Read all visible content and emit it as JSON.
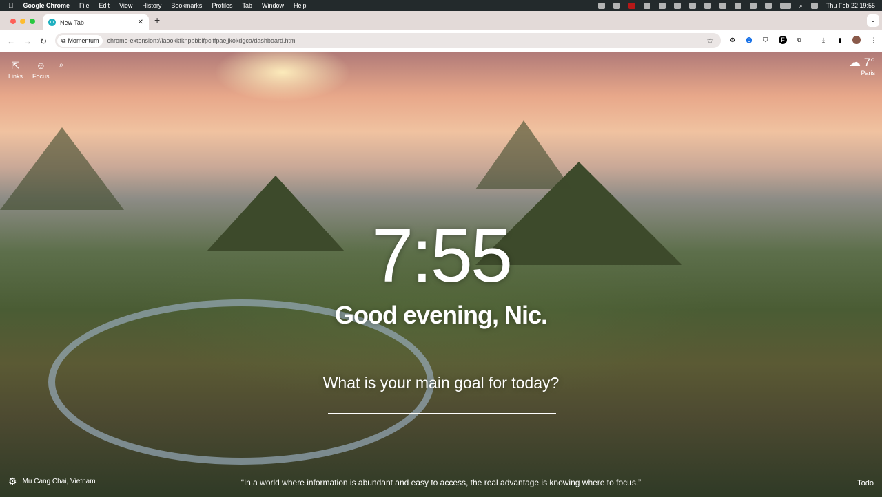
{
  "menubar": {
    "app": "Google Chrome",
    "items": [
      "File",
      "Edit",
      "View",
      "History",
      "Bookmarks",
      "Profiles",
      "Tab",
      "Window",
      "Help"
    ],
    "datetime": "Thu Feb 22  19:55"
  },
  "tab": {
    "title": "New Tab",
    "favicon": "m"
  },
  "omnibox": {
    "chip": "Momentum",
    "url": "chrome-extension://laookkfknpbbblfpciffpaejjkokdgca/dashboard.html"
  },
  "dashboard": {
    "links_label": "Links",
    "focus_label": "Focus",
    "weather": {
      "temp": "7°",
      "city": "Paris"
    },
    "clock": "7:55",
    "greeting": "Good evening, Nic.",
    "goal_question": "What is your main goal for today?",
    "location": "Mu Cang Chai, Vietnam",
    "quote": "“In a world where information is abundant and easy to access, the real advantage is knowing where to focus.”",
    "todo_label": "Todo"
  }
}
